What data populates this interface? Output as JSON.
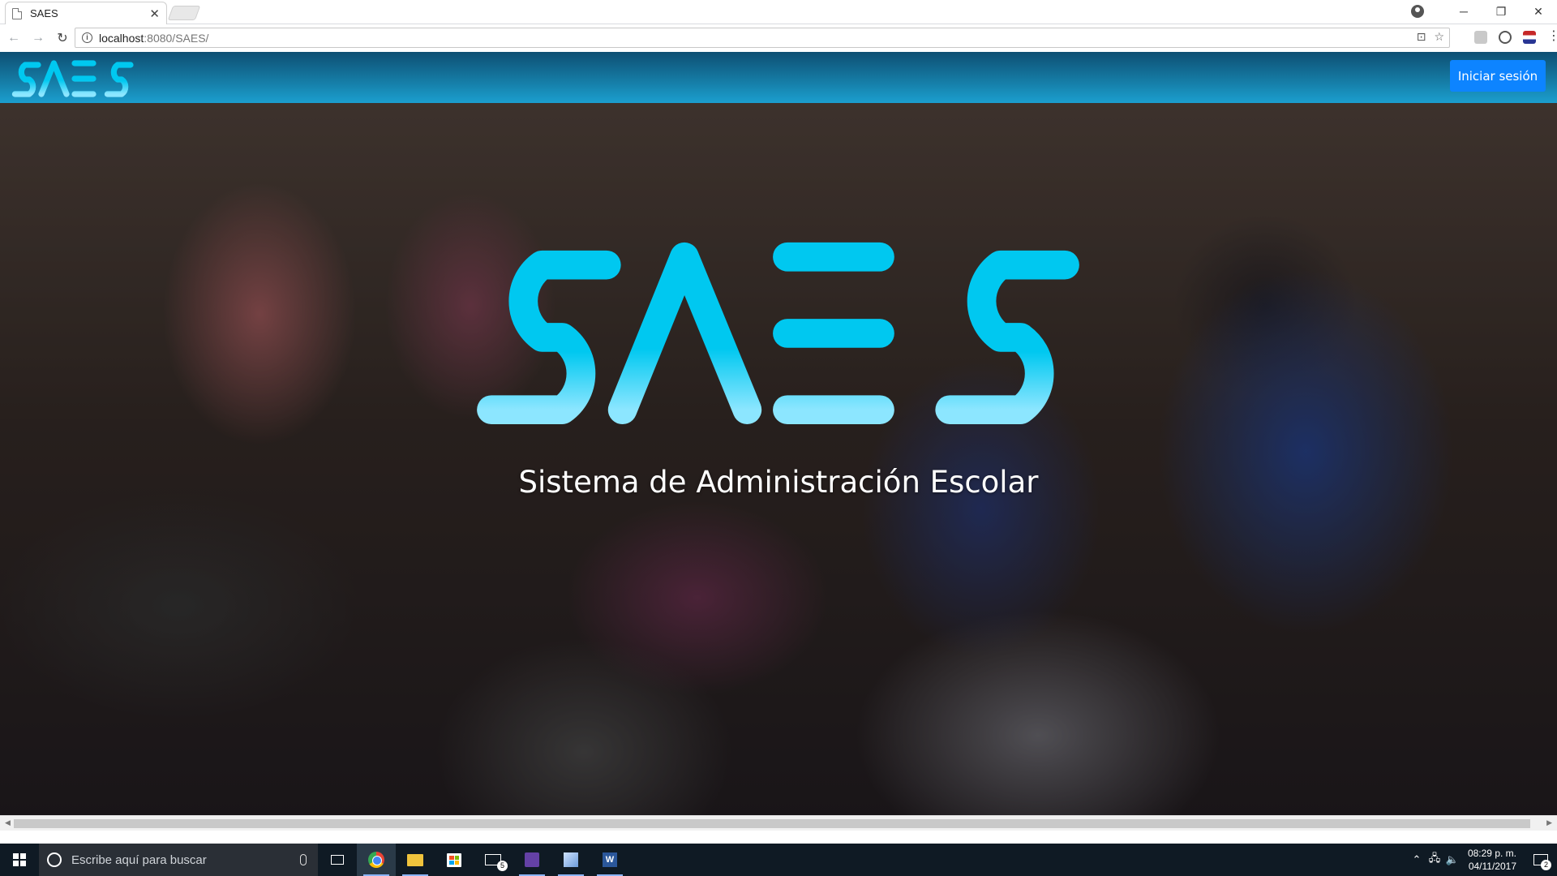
{
  "browser": {
    "tab_title": "SAES",
    "url_host": "localhost",
    "url_rest": ":8080/SAES/"
  },
  "page": {
    "logo_text": "SAES",
    "login_button": "Iniciar sesión",
    "subtitle": "Sistema de Administración Escolar",
    "colors": {
      "navbar": "#157aa3",
      "button": "#0d84ff",
      "logo_top": "#00c8f0",
      "logo_bottom": "#8ce6ff"
    }
  },
  "taskbar": {
    "search_placeholder": "Escribe aquí para buscar",
    "mail_badge": "5",
    "time": "08:29 p. m.",
    "date": "04/11/2017",
    "notification_count": "2",
    "apps": [
      "task-view-icon",
      "chrome-icon",
      "file-explorer-icon",
      "store-icon",
      "mail-icon",
      "twitch-icon",
      "box-icon",
      "word-icon"
    ]
  }
}
